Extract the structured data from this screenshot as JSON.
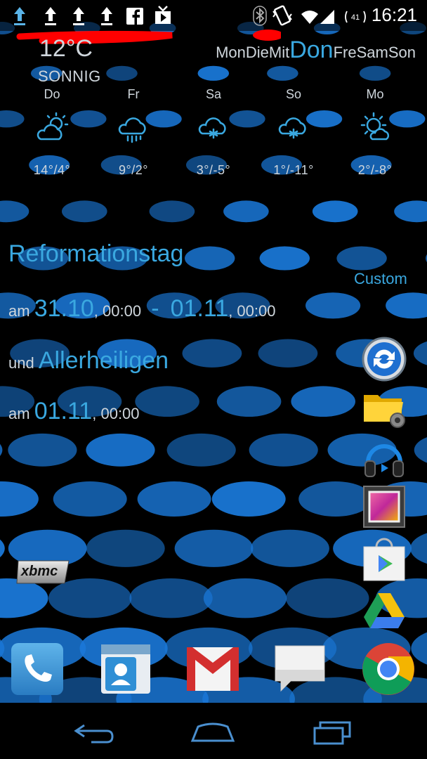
{
  "status_bar": {
    "time": "16:21",
    "left_icons": [
      "upload-icon",
      "upload-icon",
      "upload-icon",
      "upload-icon",
      "facebook-icon",
      "youtube-icon"
    ],
    "right_icons": [
      "bluetooth-icon",
      "vibrate-icon",
      "wifi-icon",
      "signal-icon",
      "battery-icon"
    ]
  },
  "weather": {
    "current_temp": "12°C",
    "condition": "SONNIG",
    "week_days": [
      "Mon",
      "Die",
      "Mit",
      "Don",
      "Fre",
      "Sam",
      "Son"
    ],
    "active_day_index": 3,
    "forecast": [
      {
        "day": "Do",
        "icon": "partly-cloudy-icon",
        "temp": "14°/4°"
      },
      {
        "day": "Fr",
        "icon": "rain-cloud-icon",
        "temp": "9°/2°"
      },
      {
        "day": "Sa",
        "icon": "snow-cloud-icon",
        "temp": "3°/-5°"
      },
      {
        "day": "So",
        "icon": "snow-cloud-icon",
        "temp": "1°/-11°"
      },
      {
        "day": "Mo",
        "icon": "partly-sunny-icon",
        "temp": "2°/-8°"
      }
    ]
  },
  "calendar": {
    "event1_title": "Reformationstag",
    "custom_label": "Custom",
    "event1_prefix": "am",
    "event1_start_date": "31.10",
    "event1_start_time": ", 00:00",
    "event1_separator": "-",
    "event1_end_date": "01.11",
    "event1_end_time": ", 00:00",
    "event2_prefix": "und",
    "event2_title": "Allerheiligen",
    "event2_date_prefix": "am",
    "event2_date": "01.11",
    "event2_time": ", 00:00"
  },
  "apps": {
    "xbmc_label": "xbmc",
    "right_column": [
      "sync-icon",
      "file-manager-icon",
      "play-music-icon",
      "gallery-icon",
      "play-store-icon",
      "drive-icon"
    ],
    "dock": [
      "phone-icon",
      "contacts-icon",
      "gmail-icon",
      "messaging-icon",
      "chrome-icon"
    ]
  },
  "colors": {
    "accent": "#3aa8e0",
    "dot_blue": "#1a78d8",
    "text_gray": "#cfd6dc"
  }
}
